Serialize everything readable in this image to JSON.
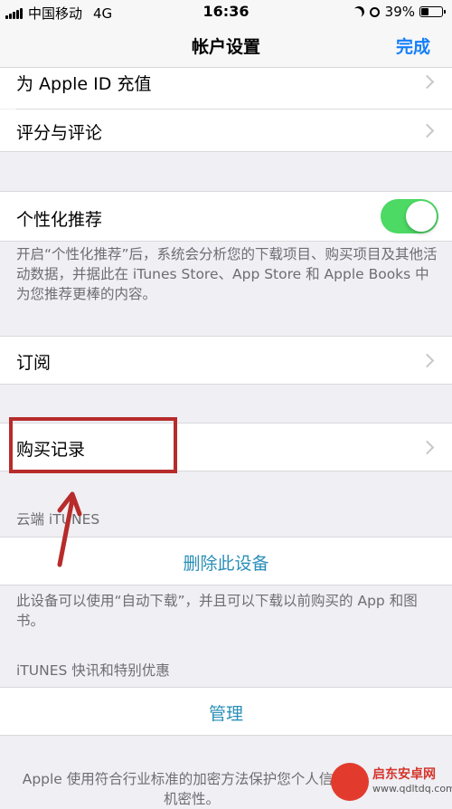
{
  "status_bar": {
    "carrier": "中国移动",
    "network": "4G",
    "time": "16:36",
    "battery": "39%",
    "battery_level": 0.39
  },
  "nav": {
    "title": "帐户设置",
    "done_label": "完成"
  },
  "rows": {
    "apple_id_topup": "为 Apple ID 充值",
    "ratings_reviews": "评分与评论",
    "personalized_recommendations": "个性化推荐",
    "subscriptions": "订阅",
    "purchase_history": "购买记录"
  },
  "personalized_toggle_on": true,
  "personalized_footnote": "开启“个性化推荐”后，系统会分析您的下载项目、购买项目及其他活动数据，并据此在 iTunes Store、App Store 和 Apple Books 中为您推荐更棒的内容。",
  "cloud_itunes": {
    "header": "云端 iTUNES",
    "remove_device_label": "删除此设备",
    "footnote": "此设备可以使用“自动下载”，并且可以下载以前购买的 App 和图书。"
  },
  "itunes_news": {
    "header": "iTUNES 快讯和特别优惠",
    "manage_label": "管理"
  },
  "bottom_footnote": "Apple 使用符合行业标准的加密方法保护您个人信息的机密性。",
  "watermark": {
    "name": "启东安卓网",
    "url": "www.qdltdq.com"
  },
  "colors": {
    "accent_blue": "#147efb",
    "toggle_green": "#4cd964",
    "link_teal": "#2a8fb8",
    "annotation_red": "#b72b2b"
  }
}
